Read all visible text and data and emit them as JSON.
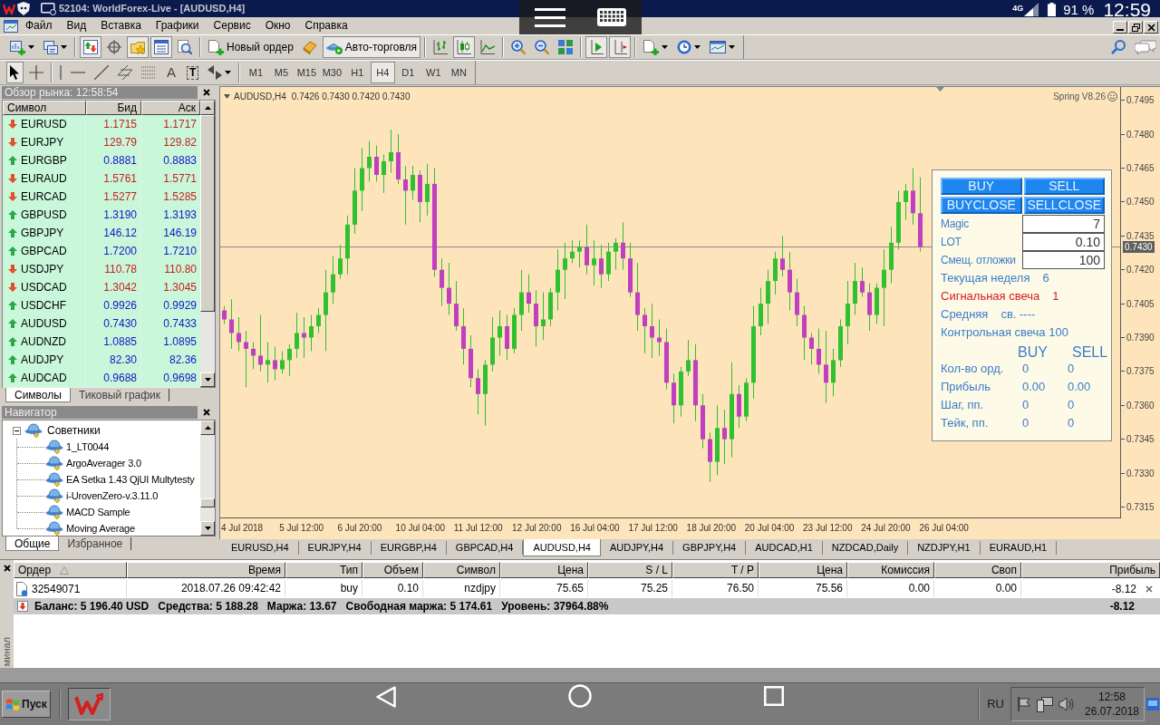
{
  "title_bar": {
    "title": "52104: WorldForex-Live - [AUDUSD,H4]"
  },
  "status_bar": {
    "network": "4G",
    "battery": "91 %",
    "time": "12:59"
  },
  "menu": [
    "Файл",
    "Вид",
    "Вставка",
    "Графики",
    "Сервис",
    "Окно",
    "Справка"
  ],
  "toolbar_groups": [
    [
      {
        "kind": "new-chart",
        "on": false
      },
      {
        "kind": "profiles",
        "on": false
      }
    ],
    [
      {
        "kind": "market-watch",
        "on": true
      },
      {
        "kind": "data-window",
        "on": false
      },
      {
        "kind": "navigator",
        "on": true
      },
      {
        "kind": "terminal",
        "on": true
      },
      {
        "kind": "tester",
        "on": false
      }
    ],
    [
      {
        "kind": "new-order",
        "label": "Новый ордер",
        "on": false
      },
      {
        "kind": "editor",
        "on": false
      },
      {
        "kind": "autotrading",
        "label": "Авто-торговля",
        "on": true
      }
    ],
    [
      {
        "kind": "bar-chart",
        "on": false
      },
      {
        "kind": "candle-chart",
        "on": true
      },
      {
        "kind": "line-chart",
        "on": false
      }
    ],
    [
      {
        "kind": "zoom-in",
        "on": false
      },
      {
        "kind": "zoom-out",
        "on": false
      },
      {
        "kind": "tile",
        "on": false
      }
    ],
    [
      {
        "kind": "autoscroll",
        "on": true
      },
      {
        "kind": "chart-shift",
        "on": true
      }
    ],
    [
      {
        "kind": "indicators",
        "on": false
      },
      {
        "kind": "periods",
        "on": false
      },
      {
        "kind": "templates",
        "on": false
      }
    ]
  ],
  "drawing_groups": [
    [
      {
        "kind": "cursor",
        "on": true
      },
      {
        "kind": "crosshair",
        "on": false
      }
    ],
    [
      {
        "kind": "vertical-line",
        "on": false
      },
      {
        "kind": "horizontal-line",
        "on": false
      },
      {
        "kind": "trendline",
        "on": false
      },
      {
        "kind": "channel",
        "on": false
      },
      {
        "kind": "fibonacci",
        "on": false
      },
      {
        "kind": "text",
        "label": "A",
        "on": false
      },
      {
        "kind": "text-label",
        "label": "T",
        "on": false
      },
      {
        "kind": "arrows",
        "on": false
      }
    ]
  ],
  "timeframes": [
    {
      "label": "M1",
      "selected": false
    },
    {
      "label": "M5",
      "selected": false
    },
    {
      "label": "M15",
      "selected": false
    },
    {
      "label": "M30",
      "selected": false
    },
    {
      "label": "H1",
      "selected": false
    },
    {
      "label": "H4",
      "selected": true
    },
    {
      "label": "D1",
      "selected": false
    },
    {
      "label": "W1",
      "selected": false
    },
    {
      "label": "MN",
      "selected": false
    }
  ],
  "market_watch": {
    "title": "Обзор рынка: 12:58:54",
    "columns": [
      "Символ",
      "Бид",
      "Аск"
    ],
    "rows": [
      {
        "kind": "down",
        "symbol": "EURUSD",
        "bid": "1.1715",
        "ask": "1.1717"
      },
      {
        "kind": "down",
        "symbol": "EURJPY",
        "bid": "129.79",
        "ask": "129.82"
      },
      {
        "kind": "up",
        "symbol": "EURGBP",
        "bid": "0.8881",
        "ask": "0.8883"
      },
      {
        "kind": "down",
        "symbol": "EURAUD",
        "bid": "1.5761",
        "ask": "1.5771"
      },
      {
        "kind": "down",
        "symbol": "EURCAD",
        "bid": "1.5277",
        "ask": "1.5285"
      },
      {
        "kind": "up",
        "symbol": "GBPUSD",
        "bid": "1.3190",
        "ask": "1.3193"
      },
      {
        "kind": "up",
        "symbol": "GBPJPY",
        "bid": "146.12",
        "ask": "146.19"
      },
      {
        "kind": "up",
        "symbol": "GBPCAD",
        "bid": "1.7200",
        "ask": "1.7210"
      },
      {
        "kind": "down",
        "symbol": "USDJPY",
        "bid": "110.78",
        "ask": "110.80"
      },
      {
        "kind": "down",
        "symbol": "USDCAD",
        "bid": "1.3042",
        "ask": "1.3045"
      },
      {
        "kind": "up",
        "symbol": "USDCHF",
        "bid": "0.9926",
        "ask": "0.9929"
      },
      {
        "kind": "up",
        "symbol": "AUDUSD",
        "bid": "0.7430",
        "ask": "0.7433"
      },
      {
        "kind": "up",
        "symbol": "AUDNZD",
        "bid": "1.0885",
        "ask": "1.0895"
      },
      {
        "kind": "up",
        "symbol": "AUDJPY",
        "bid": "82.30",
        "ask": "82.36"
      },
      {
        "kind": "up",
        "symbol": "AUDCAD",
        "bid": "0.9688",
        "ask": "0.9698"
      }
    ],
    "tabs": [
      {
        "label": "Символы",
        "selected": true
      },
      {
        "label": "Тиковый график",
        "selected": false
      }
    ]
  },
  "navigator": {
    "title": "Навигатор",
    "tree": [
      {
        "label": "Советники",
        "expanded": true,
        "children": [
          {
            "label": "1_LT0044"
          },
          {
            "label": "ArgoAverager 3.0"
          },
          {
            "label": "EA Setka 1.43 QjUI Multytesty"
          },
          {
            "label": "i-UrovenZero-v.3.11.0"
          },
          {
            "label": "MACD Sample"
          },
          {
            "label": "Moving Average"
          }
        ]
      }
    ],
    "tabs": [
      {
        "label": "Общие",
        "selected": true
      },
      {
        "label": "Избранное",
        "selected": false
      }
    ]
  },
  "chart": {
    "symbol": "AUDUSD,H4",
    "quote": "0.7426 0.7430 0.7420 0.7430",
    "expert": "Spring V8.26",
    "price_labels": [
      "0.7495",
      "0.7480",
      "0.7465",
      "0.7450",
      "0.7435",
      "0.7420",
      "0.7405",
      "0.7390",
      "0.7375",
      "0.7360",
      "0.7345",
      "0.7330",
      "0.7315"
    ],
    "current_price": "0.7430",
    "time_labels": [
      "4 Jul 2018",
      "5 Jul 12:00",
      "6 Jul 20:00",
      "10 Jul 04:00",
      "11 Jul 12:00",
      "12 Jul 20:00",
      "16 Jul 04:00",
      "17 Jul 12:00",
      "18 Jul 20:00",
      "20 Jul 04:00",
      "23 Jul 12:00",
      "24 Jul 20:00",
      "26 Jul 04:00"
    ]
  },
  "ea_panel": {
    "buttons": [
      "BUY",
      "SELL",
      "BUYCLOSE",
      "SELLCLOSE"
    ],
    "fields": [
      {
        "label": "Magic",
        "value": "7"
      },
      {
        "label": "LOT",
        "value": "0.10"
      },
      {
        "label": "Смещ. отложки",
        "value": "100"
      }
    ],
    "info": [
      {
        "label": "Текущая неделя",
        "value": "6",
        "color": "#3c7cc8"
      },
      {
        "label": "Сигнальная свеча",
        "value": "1",
        "color": "#d41c1c"
      },
      {
        "label": "Средняя",
        "value": "св. ----",
        "color": "#3c7cc8"
      },
      {
        "label": "Контрольная свеча 100",
        "color": "#3c7cc8"
      }
    ],
    "stats_header": [
      "BUY",
      "SELL"
    ],
    "stats": [
      {
        "label": "Кол-во орд.",
        "buy": "0",
        "sell": "0"
      },
      {
        "label": "Прибыль",
        "buy": "0.00",
        "sell": "0.00"
      },
      {
        "label": "Шаг, пп.",
        "buy": "0",
        "sell": "0"
      },
      {
        "label": "Тейк, пп.",
        "buy": "0",
        "sell": "0"
      }
    ]
  },
  "chart_tabs": [
    {
      "label": "EURUSD,H4",
      "selected": false
    },
    {
      "label": "EURJPY,H4",
      "selected": false
    },
    {
      "label": "EURGBP,H4",
      "selected": false
    },
    {
      "label": "GBPCAD,H4",
      "selected": false
    },
    {
      "label": "AUDUSD,H4",
      "selected": true
    },
    {
      "label": "AUDJPY,H4",
      "selected": false
    },
    {
      "label": "GBPJPY,H4",
      "selected": false
    },
    {
      "label": "AUDCAD,H1",
      "selected": false
    },
    {
      "label": "NZDCAD,Daily",
      "selected": false
    },
    {
      "label": "NZDJPY,H1",
      "selected": false
    },
    {
      "label": "EURAUD,H1",
      "selected": false
    }
  ],
  "terminal": {
    "tab": "минал",
    "columns": [
      {
        "label": "Ордер",
        "sorted": true
      },
      {
        "label": "Время",
        "sorted": false
      },
      {
        "label": "Тип",
        "sorted": false
      },
      {
        "label": "Объем",
        "sorted": false
      },
      {
        "label": "Символ",
        "sorted": false
      },
      {
        "label": "Цена",
        "sorted": false
      },
      {
        "label": "S / L",
        "sorted": false
      },
      {
        "label": "T / P",
        "sorted": false
      },
      {
        "label": "Цена",
        "sorted": false
      },
      {
        "label": "Комиссия",
        "sorted": false
      },
      {
        "label": "Своп",
        "sorted": false
      },
      {
        "label": "Прибыль",
        "sorted": false
      }
    ],
    "rows": [
      {
        "cells": [
          "32549071",
          "2018.07.26 09:42:42",
          "buy",
          "0.10",
          "nzdjpy",
          "75.65",
          "75.25",
          "76.50",
          "75.56",
          "0.00",
          "0.00",
          "-8.12"
        ]
      }
    ],
    "summary": {
      "items": [
        "Баланс: 5 196.40 USD",
        "Средства: 5 188.28",
        "Маржа: 13.67",
        "Свободная маржа: 5 174.61",
        "Уровень: 37964.88%"
      ],
      "profit": "-8.12"
    }
  },
  "taskbar": {
    "start": "Пуск",
    "language": "RU",
    "time": "12:58",
    "date": "26.07.2018"
  }
}
